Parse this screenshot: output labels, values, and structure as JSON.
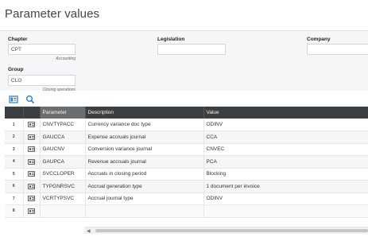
{
  "page": {
    "title": "Parameter values"
  },
  "form": {
    "chapter": {
      "label": "Chapter",
      "value": "CPT",
      "hint": "Accounting"
    },
    "legislation": {
      "label": "Legislation",
      "value": ""
    },
    "company": {
      "label": "Company",
      "value": ""
    },
    "group": {
      "label": "Group",
      "value": "CLO",
      "hint": "Closing operations"
    }
  },
  "toolbar": {
    "icons": [
      "list-view-icon",
      "search-icon"
    ]
  },
  "grid": {
    "columns": [
      "",
      "",
      "Parameter",
      "Description",
      "Value"
    ],
    "rows": [
      {
        "num": "1",
        "parameter": "CNVTYPACC",
        "description": "Currency variance doc type",
        "value": "ODINV"
      },
      {
        "num": "2",
        "parameter": "GAUCCA",
        "description": "Expense accruals journal",
        "value": "CCA"
      },
      {
        "num": "3",
        "parameter": "GAUCNV",
        "description": "Conversion variance journal",
        "value": "CNVEC"
      },
      {
        "num": "4",
        "parameter": "GAUPCA",
        "description": "Revenue accruals journal",
        "value": "PCA"
      },
      {
        "num": "5",
        "parameter": "SVCCLOPER",
        "description": "Accruals in closing period",
        "value": "Blocking"
      },
      {
        "num": "6",
        "parameter": "TYPGNRSVC",
        "description": "Accrual generation type",
        "value": "1 document per invoice"
      },
      {
        "num": "7",
        "parameter": "VCRTYPSVC",
        "description": "Accrual journal type",
        "value": "ODINV"
      },
      {
        "num": "8",
        "parameter": "",
        "description": "",
        "value": ""
      }
    ]
  },
  "colors": {
    "header_bg": "#3c3f41",
    "accent": "#2a7fc1"
  }
}
